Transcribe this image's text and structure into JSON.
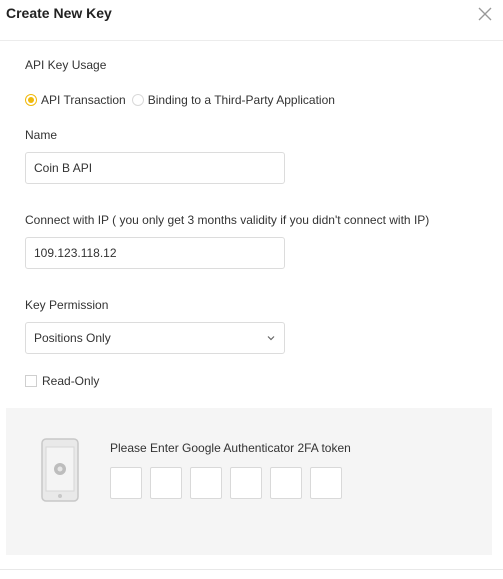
{
  "dialog": {
    "title": "Create New Key"
  },
  "api_key_usage": {
    "label": "API Key Usage",
    "options": [
      {
        "label": "API Transaction",
        "checked": true
      },
      {
        "label": "Binding to a Third-Party Application",
        "checked": false
      }
    ]
  },
  "name_field": {
    "label": "Name",
    "value": "Coin B API"
  },
  "ip_field": {
    "label": "Connect with IP ( you only get 3 months validity if you didn't connect with IP)",
    "value": "109.123.118.12"
  },
  "permission": {
    "label": "Key Permission",
    "selected": "Positions Only"
  },
  "read_only": {
    "label": "Read-Only",
    "checked": false
  },
  "two_fa": {
    "prompt": "Please Enter Google Authenticator 2FA token",
    "digits": [
      "",
      "",
      "",
      "",
      "",
      ""
    ]
  },
  "colors": {
    "accent": "#f0b90b",
    "panel_bg": "#f5f5f5",
    "border": "#dcdcdc"
  },
  "icons": {
    "close": "close-icon",
    "dropdown": "chevron-down-icon",
    "phone": "phone-icon"
  }
}
